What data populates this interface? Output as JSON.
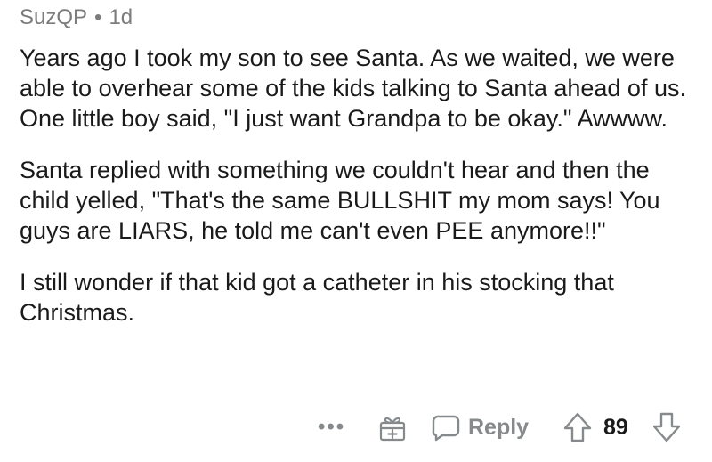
{
  "comment": {
    "author": "SuzQP",
    "separator": "•",
    "age": "1d",
    "paragraphs": [
      "Years ago I took my son to see Santa. As we waited, we were able to overhear some of the kids talking to Santa ahead of us. One little boy said, \"I just want Grandpa to be okay.\" Awwww.",
      "Santa replied with something we couldn't hear and then the child yelled, \"That's the same BULLSHIT my mom says! You guys are LIARS, he told me can't even PEE anymore!!\"",
      "I still wonder if that kid got a catheter in his stocking that Christmas."
    ]
  },
  "actions": {
    "more_label": "•••",
    "reply_label": "Reply",
    "score": "89"
  },
  "icons": {
    "award": "gift-icon",
    "reply": "speech-bubble-icon",
    "upvote": "upvote-arrow-icon",
    "downvote": "downvote-arrow-icon"
  }
}
